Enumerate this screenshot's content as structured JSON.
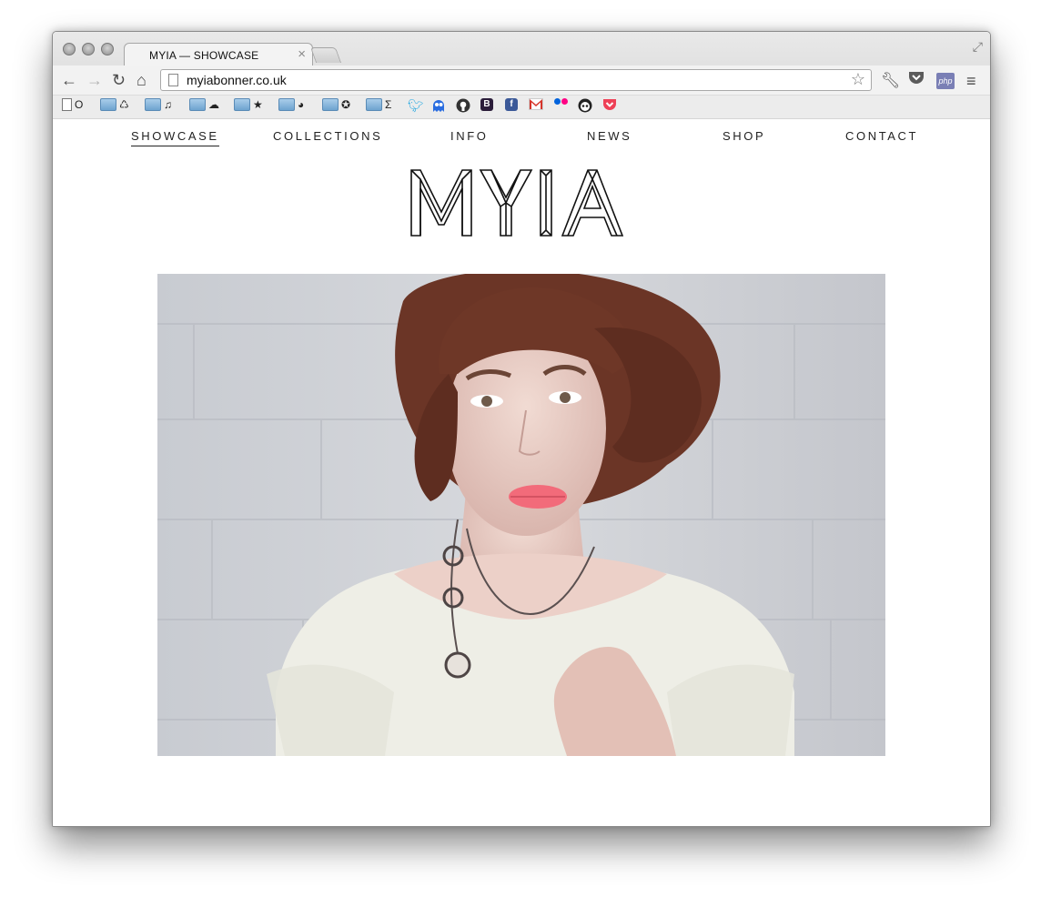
{
  "browser": {
    "tab_title": "MYIA — SHOWCASE",
    "url": "myiabonner.co.uk",
    "bookmarks": [
      {
        "label": "O",
        "icon": "page-icon"
      },
      {
        "label": "♺",
        "icon": "folder-icon"
      },
      {
        "label": "♫",
        "icon": "folder-icon"
      },
      {
        "label": "☁",
        "icon": "folder-icon"
      },
      {
        "label": "★",
        "icon": "folder-icon"
      },
      {
        "label": "◕",
        "icon": "folder-icon"
      },
      {
        "label": "✪",
        "icon": "folder-icon"
      },
      {
        "label": "Σ",
        "icon": "folder-icon"
      }
    ],
    "favicon_letters": {
      "bootstrap": "B",
      "facebook": "f",
      "php": "php"
    }
  },
  "site": {
    "nav": [
      "SHOWCASE",
      "COLLECTIONS",
      "INFO",
      "NEWS",
      "SHOP",
      "CONTACT"
    ],
    "active_nav": "SHOWCASE",
    "logo_text": "MYIA"
  },
  "colors": {
    "nav_text": "#222222",
    "twitter": "#29a9e1",
    "facebook": "#3b5998",
    "gmail": "#d6342a",
    "flickr_blue": "#0063dc",
    "flickr_pink": "#ff0084",
    "pocket": "#ee4056",
    "lips": "#f26b7a"
  }
}
